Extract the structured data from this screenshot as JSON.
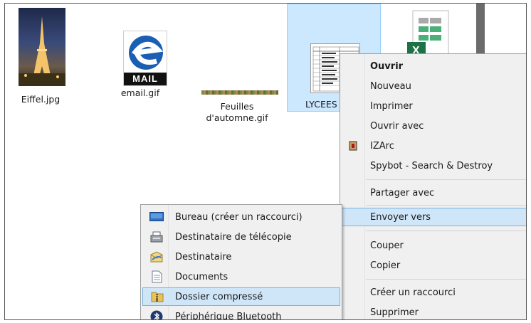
{
  "files": [
    {
      "name": "Eiffel.jpg",
      "icon": "eiffel-image-icon"
    },
    {
      "name": "email.gif",
      "icon": "email-gif-icon",
      "badge": "MAIL"
    },
    {
      "name_line1": "Feuilles",
      "name_line2": "d'automne.gif",
      "icon": "autumn-leaves-gif-icon"
    },
    {
      "name": "LYCEES",
      "icon": "spreadsheet-document-icon"
    },
    {
      "name": "",
      "icon": "excel-file-icon"
    }
  ],
  "context_menu": {
    "items": [
      {
        "label": "Ouvrir",
        "bold": true
      },
      {
        "label": "Nouveau"
      },
      {
        "label": "Imprimer"
      },
      {
        "label": "Ouvrir avec"
      },
      {
        "label": "IZArc",
        "icon": "izarc-icon"
      },
      {
        "label": "Spybot - Search & Destroy"
      },
      {
        "label": "Partager avec"
      },
      {
        "label": "Envoyer vers"
      },
      {
        "label": "Couper"
      },
      {
        "label": "Copier"
      },
      {
        "label": "Créer un raccourci"
      },
      {
        "label": "Supprimer"
      }
    ]
  },
  "send_to_menu": {
    "items": [
      {
        "label": "Bureau (créer un raccourci)",
        "icon": "desktop-icon"
      },
      {
        "label": "Destinataire de télécopie",
        "icon": "fax-icon"
      },
      {
        "label": "Destinataire",
        "icon": "mail-recipient-icon"
      },
      {
        "label": "Documents",
        "icon": "documents-icon"
      },
      {
        "label": "Dossier compressé",
        "icon": "zip-folder-icon"
      },
      {
        "label": "Périphérique Bluetooth",
        "icon": "bluetooth-icon"
      }
    ]
  },
  "colors": {
    "highlight": "#cfe6f8",
    "selection": "#cce8ff",
    "menu_bg": "#f0f0f0"
  }
}
